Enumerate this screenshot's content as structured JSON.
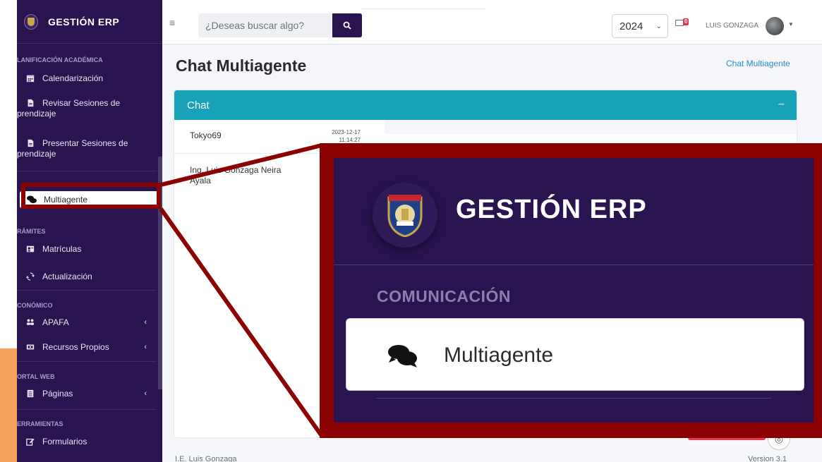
{
  "sidebar": {
    "brand": "GESTIÓN ERP",
    "sections": {
      "planificacion": "LANIFICACIÓN ACADÉMICA",
      "tramites": "RÁMITES",
      "economico": "CONÓMICO",
      "portal": "ORTAL WEB",
      "herramientas": "ERRAMIENTAS"
    },
    "items": {
      "calendarizacion": "Calendarización",
      "revisar_1": "Revisar Sesiones de",
      "revisar_2": "prendizaje",
      "presentar_1": "Presentar Sesiones de",
      "presentar_2": "prendizaje",
      "multiagente": "Multiagente",
      "matriculas": "Matrículas",
      "actualizacion": "Actualización",
      "apafa": "APAFA",
      "recursos": "Recursos Propios",
      "paginas": "Páginas",
      "formularios": "Formularios"
    },
    "chevron": "‹"
  },
  "topbar": {
    "menu_icon": "≡",
    "search_placeholder": "¿Deseas buscar algo?",
    "year": "2024",
    "mail_badge": "0",
    "user": "LUIS GONZAGA"
  },
  "page": {
    "title": "Chat Multiagente",
    "breadcrumb": "Chat Multiagente"
  },
  "chat": {
    "header": "Chat",
    "collapse": "−",
    "contacts": [
      {
        "name": "Tokyo69",
        "date": "2023-12-17",
        "time": "11:14:27"
      },
      {
        "name": "Ing. Luis Gonzaga Neira Ayala"
      }
    ]
  },
  "footer": {
    "left": "I.E. Luis Gonzaga",
    "right": "Version 3.1"
  },
  "zoom": {
    "brand": "GESTIÓN ERP",
    "section": "COMUNICACIÓN",
    "item": "Multiagente"
  },
  "colors": {
    "sidebar_bg": "#2a1450",
    "card_header": "#17a2b8",
    "highlight": "#8b0000",
    "accent_orange": "#f6a15c"
  }
}
